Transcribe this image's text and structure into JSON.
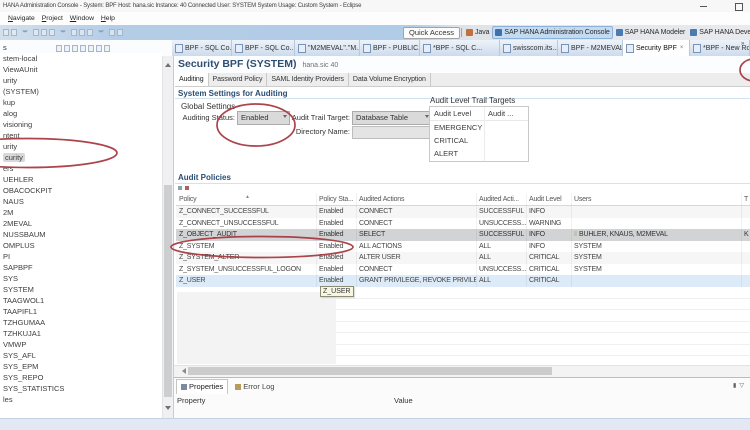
{
  "window": {
    "title": "HANA Administration Console - System: BPF Host: hana.sic Instance: 40 Connected User: SYSTEM System Usage: Custom System - Eclipse"
  },
  "menubar": {
    "items": [
      "Navigate",
      "Project",
      "Window",
      "Help"
    ]
  },
  "toolbar": {
    "quick_access": "Quick Access",
    "perspectives": [
      {
        "label": "Java",
        "active": false
      },
      {
        "label": "SAP HANA Administration Console",
        "active": true
      },
      {
        "label": "SAP HANA Modeler",
        "active": false
      },
      {
        "label": "SAP HANA Devel",
        "active": false
      }
    ]
  },
  "editor_tabs": [
    {
      "label": "BPF - SQL Co...",
      "active": false
    },
    {
      "label": "BPF - SQL Co...",
      "active": false
    },
    {
      "label": "\"M2MEVAL\".\"M...",
      "active": false
    },
    {
      "label": "BPF - PUBLIC...",
      "active": false
    },
    {
      "label": "*BPF - SQL C...",
      "active": false
    },
    {
      "label": "swisscom.its...",
      "active": false
    },
    {
      "label": "BPF - M2MEVAL",
      "active": false
    },
    {
      "label": "Security BPF",
      "active": true
    },
    {
      "label": "*BPF - New Role",
      "active": false
    }
  ],
  "systems_view": {
    "tab_label": "s",
    "items": [
      {
        "label": "stem-local"
      },
      {
        "label": "ViewAUnit"
      },
      {
        "label": "urity"
      },
      {
        "label": "(SYSTEM)"
      },
      {
        "label": "kup"
      },
      {
        "label": "alog"
      },
      {
        "label": "visioning"
      },
      {
        "label": "ntent"
      },
      {
        "label": "urity"
      },
      {
        "label": "curity",
        "selected": true
      },
      {
        "label": "ers"
      },
      {
        "label": "UEHLER"
      },
      {
        "label": "OBACOCKPIT"
      },
      {
        "label": "NAUS"
      },
      {
        "label": "2M"
      },
      {
        "label": "2MEVAL"
      },
      {
        "label": "NUSSBAUM"
      },
      {
        "label": "OMPLUS"
      },
      {
        "label": "PI"
      },
      {
        "label": "SAPBPF"
      },
      {
        "label": "SYS"
      },
      {
        "label": "SYSTEM"
      },
      {
        "label": "TAAGWOL1"
      },
      {
        "label": "TAAPIFL1"
      },
      {
        "label": "TZHGUMAA"
      },
      {
        "label": "TZHKUJA1"
      },
      {
        "label": "VMWP"
      },
      {
        "label": "SYS_AFL"
      },
      {
        "label": "SYS_EPM"
      },
      {
        "label": "SYS_REPO"
      },
      {
        "label": "SYS_STATISTICS"
      },
      {
        "label": "les"
      }
    ]
  },
  "editor": {
    "title": "Security BPF (SYSTEM)",
    "subtitle": "hana.sic 40",
    "subtabs": [
      {
        "label": "Auditing",
        "active": true
      },
      {
        "label": "Password Policy",
        "active": false
      },
      {
        "label": "SAML Identity Providers",
        "active": false
      },
      {
        "label": "Data Volume Encryption",
        "active": false
      }
    ],
    "settings": {
      "section_title": "System Settings for Auditing",
      "group_label": "Global Settings",
      "auditing_status_label": "Auditing Status:",
      "auditing_status_value": "Enabled",
      "audit_trail_target_label": "Audit Trail Target:",
      "audit_trail_target_value": "Database Table",
      "directory_name_label": "Directory Name:",
      "trail_targets": {
        "title": "Audit Level Trail Targets",
        "columns": [
          "Audit Level",
          "Audit ..."
        ],
        "rows": [
          "EMERGENCY",
          "CRITICAL",
          "ALERT"
        ]
      }
    },
    "policies": {
      "section_title": "Audit Policies",
      "columns": [
        "Policy",
        "Policy Sta...",
        "Audited Actions",
        "Audited Acti...",
        "Audit Level",
        "Users",
        "T"
      ],
      "rows": [
        {
          "cells": [
            "Z_CONNECT_SUCCESSFUL",
            "Enabled",
            "CONNECT",
            "SUCCESSFUL",
            "INFO",
            "",
            ""
          ],
          "state": "alt"
        },
        {
          "cells": [
            "Z_CONNECT_UNSUCCESSFUL",
            "Enabled",
            "CONNECT",
            "UNSUCCESS...",
            "WARNING",
            "",
            ""
          ],
          "state": ""
        },
        {
          "cells": [
            "Z_OBJECT_AUDIT",
            "Enabled",
            "SELECT",
            "SUCCESSFUL",
            "INFO",
            "BUHLER, KNAUS, M2MEVAL",
            "K"
          ],
          "state": "sel"
        },
        {
          "cells": [
            "Z_SYSTEM",
            "Enabled",
            "ALL ACTIONS",
            "ALL",
            "INFO",
            "SYSTEM",
            ""
          ],
          "state": ""
        },
        {
          "cells": [
            "Z_SYSTEM_ALTER",
            "Enabled",
            "ALTER USER",
            "ALL",
            "CRITICAL",
            "SYSTEM",
            ""
          ],
          "state": "alt"
        },
        {
          "cells": [
            "Z_SYSTEM_UNSUCCESSFUL_LOGON",
            "Enabled",
            "CONNECT",
            "UNSUCCESS...",
            "CRITICAL",
            "SYSTEM",
            ""
          ],
          "state": ""
        },
        {
          "cells": [
            "Z_USER",
            "Enabled",
            "GRANT PRIVILEGE, REVOKE PRIVILEG...",
            "ALL",
            "CRITICAL",
            "",
            ""
          ],
          "state": "hl"
        }
      ],
      "tooltip": "Z_USER"
    }
  },
  "bottom_panel": {
    "tabs": [
      {
        "label": "Properties",
        "active": true
      },
      {
        "label": "Error Log",
        "active": false
      }
    ],
    "columns": [
      "Property",
      "Value"
    ]
  },
  "annotation_color": "#a63a41"
}
